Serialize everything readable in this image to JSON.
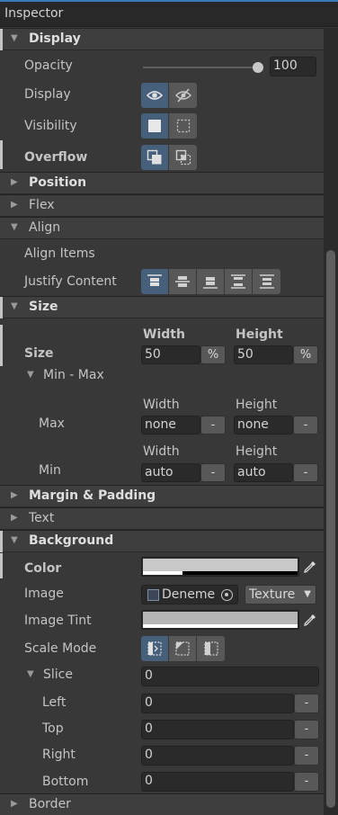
{
  "window": {
    "title": "Inspector"
  },
  "display": {
    "header": "Display",
    "opacity_label": "Opacity",
    "opacity_value": "100",
    "opacity_fraction": 1.0,
    "display_label": "Display",
    "visibility_label": "Visibility",
    "overflow_label": "Overflow"
  },
  "sections": {
    "position": "Position",
    "flex": "Flex",
    "align": "Align",
    "size": "Size",
    "margin_padding": "Margin & Padding",
    "text": "Text",
    "background": "Background",
    "border": "Border"
  },
  "align": {
    "align_items_label": "Align Items",
    "justify_content_label": "Justify Content"
  },
  "size": {
    "width_header": "Width",
    "height_header": "Height",
    "size_label": "Size",
    "width_value": "50",
    "height_value": "50",
    "width_unit": "%",
    "height_unit": "%",
    "minmax_label": "Min - Max",
    "max_label": "Max",
    "max_width_header": "Width",
    "max_height_header": "Height",
    "max_width_value": "none",
    "max_height_value": "none",
    "max_width_unit": "-",
    "max_height_unit": "-",
    "min_label": "Min",
    "min_width_header": "Width",
    "min_height_header": "Height",
    "min_width_value": "auto",
    "min_height_value": "auto",
    "min_width_unit": "-",
    "min_height_unit": "-"
  },
  "background": {
    "color_label": "Color",
    "color_hex": "#c8c8c8",
    "image_label": "Image",
    "image_value": "Deneme",
    "image_type": "Texture",
    "image_tint_label": "Image Tint",
    "image_tint_hex": "#b4b4b4",
    "scale_mode_label": "Scale Mode",
    "slice_label": "Slice",
    "slice_value": "0",
    "left_label": "Left",
    "left_value": "0",
    "left_unit": "-",
    "top_label": "Top",
    "top_value": "0",
    "top_unit": "-",
    "right_label": "Right",
    "right_value": "0",
    "right_unit": "-",
    "bottom_label": "Bottom",
    "bottom_value": "0",
    "bottom_unit": "-"
  },
  "colors": {
    "accent": "#3a79bb",
    "toggle_on": "#46607c",
    "panel_bg": "#383838"
  }
}
